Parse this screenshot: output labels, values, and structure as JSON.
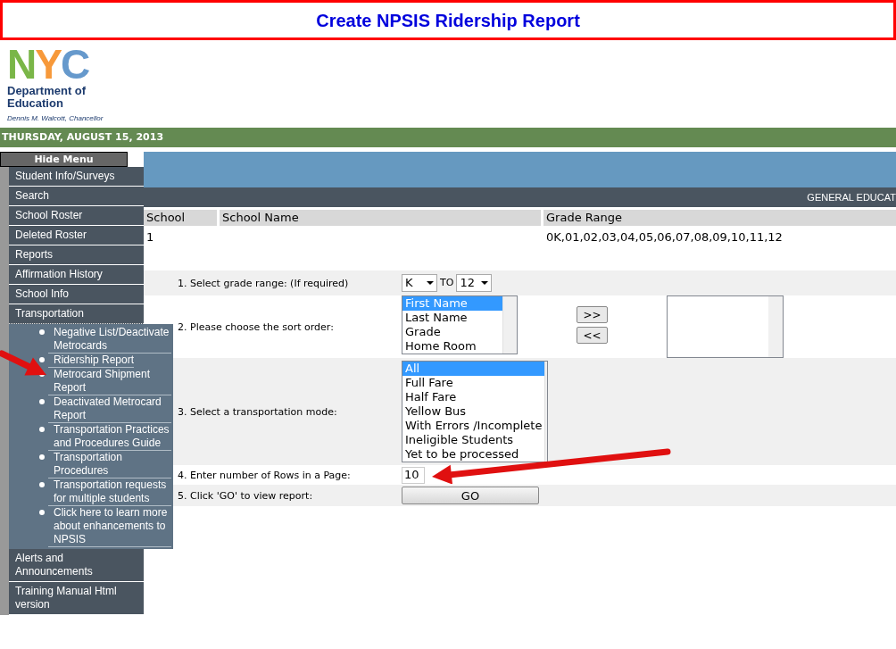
{
  "title": "Create NPSIS Ridership Report",
  "logo": {
    "letters": [
      {
        "text": "N",
        "color": "#7ab648"
      },
      {
        "text": "Y",
        "color": "#f7993a"
      },
      {
        "text": "C",
        "color": "#6699cc"
      }
    ],
    "department": "Department of Education",
    "chancellor": "Dennis M. Walcott, Chancellor"
  },
  "date": "THURSDAY, AUGUST 15, 2013",
  "hide_menu": "Hide Menu",
  "sidebar": {
    "items": [
      {
        "label": "Student Info/Surveys"
      },
      {
        "label": "Search"
      },
      {
        "label": "School Roster"
      },
      {
        "label": "Deleted Roster"
      },
      {
        "label": "Reports"
      },
      {
        "label": "Affirmation History"
      },
      {
        "label": "School Info"
      },
      {
        "label": "Transportation",
        "expanded": true,
        "children": [
          {
            "label": "Negative List/Deactivate Metrocards"
          },
          {
            "label": "Ridership Report"
          },
          {
            "label": "Metrocard Shipment Report"
          },
          {
            "label": "Deactivated Metrocard Report"
          },
          {
            "label": "Transportation Practices and Procedures Guide"
          },
          {
            "label": "Transportation Procedures"
          },
          {
            "label": "Transportation requests for multiple students"
          },
          {
            "label": "Click here to learn more about enhancements to NPSIS"
          }
        ]
      },
      {
        "label": "Alerts and Announcements"
      },
      {
        "label": "Training Manual Html version"
      }
    ]
  },
  "section_label": "GENERAL EDUCAT",
  "table": {
    "columns": [
      "School",
      "School Name",
      "Grade Range"
    ],
    "rows": [
      [
        "1",
        "",
        "0K,01,02,03,04,05,06,07,08,09,10,11,12"
      ]
    ]
  },
  "form": [
    {
      "kind": "range",
      "label": "1. Select grade range: (If required)",
      "from": "K",
      "to_label": "TO",
      "to": "12"
    },
    {
      "kind": "sort",
      "label": "2. Please choose the sort order:",
      "options": [
        {
          "text": "First Name",
          "selected": true
        },
        {
          "text": "Last Name",
          "selected": false
        },
        {
          "text": "Grade",
          "selected": false
        },
        {
          "text": "Home Room",
          "selected": false
        }
      ],
      "add": ">>",
      "remove": "<<"
    },
    {
      "kind": "list",
      "label": "3. Select a transportation mode:",
      "options": [
        {
          "text": "All",
          "selected": true
        },
        {
          "text": "Full Fare",
          "selected": false
        },
        {
          "text": "Half Fare",
          "selected": false
        },
        {
          "text": "Yellow Bus",
          "selected": false
        },
        {
          "text": "With Errors /Incomplete",
          "selected": false
        },
        {
          "text": "Ineligible Students",
          "selected": false
        },
        {
          "text": "Yet to be processed",
          "selected": false
        }
      ]
    },
    {
      "kind": "input",
      "label": "4. Enter number of Rows in a Page:",
      "value": "10"
    },
    {
      "kind": "button",
      "label": "5. Click 'GO' to view report:",
      "button": "GO"
    }
  ]
}
